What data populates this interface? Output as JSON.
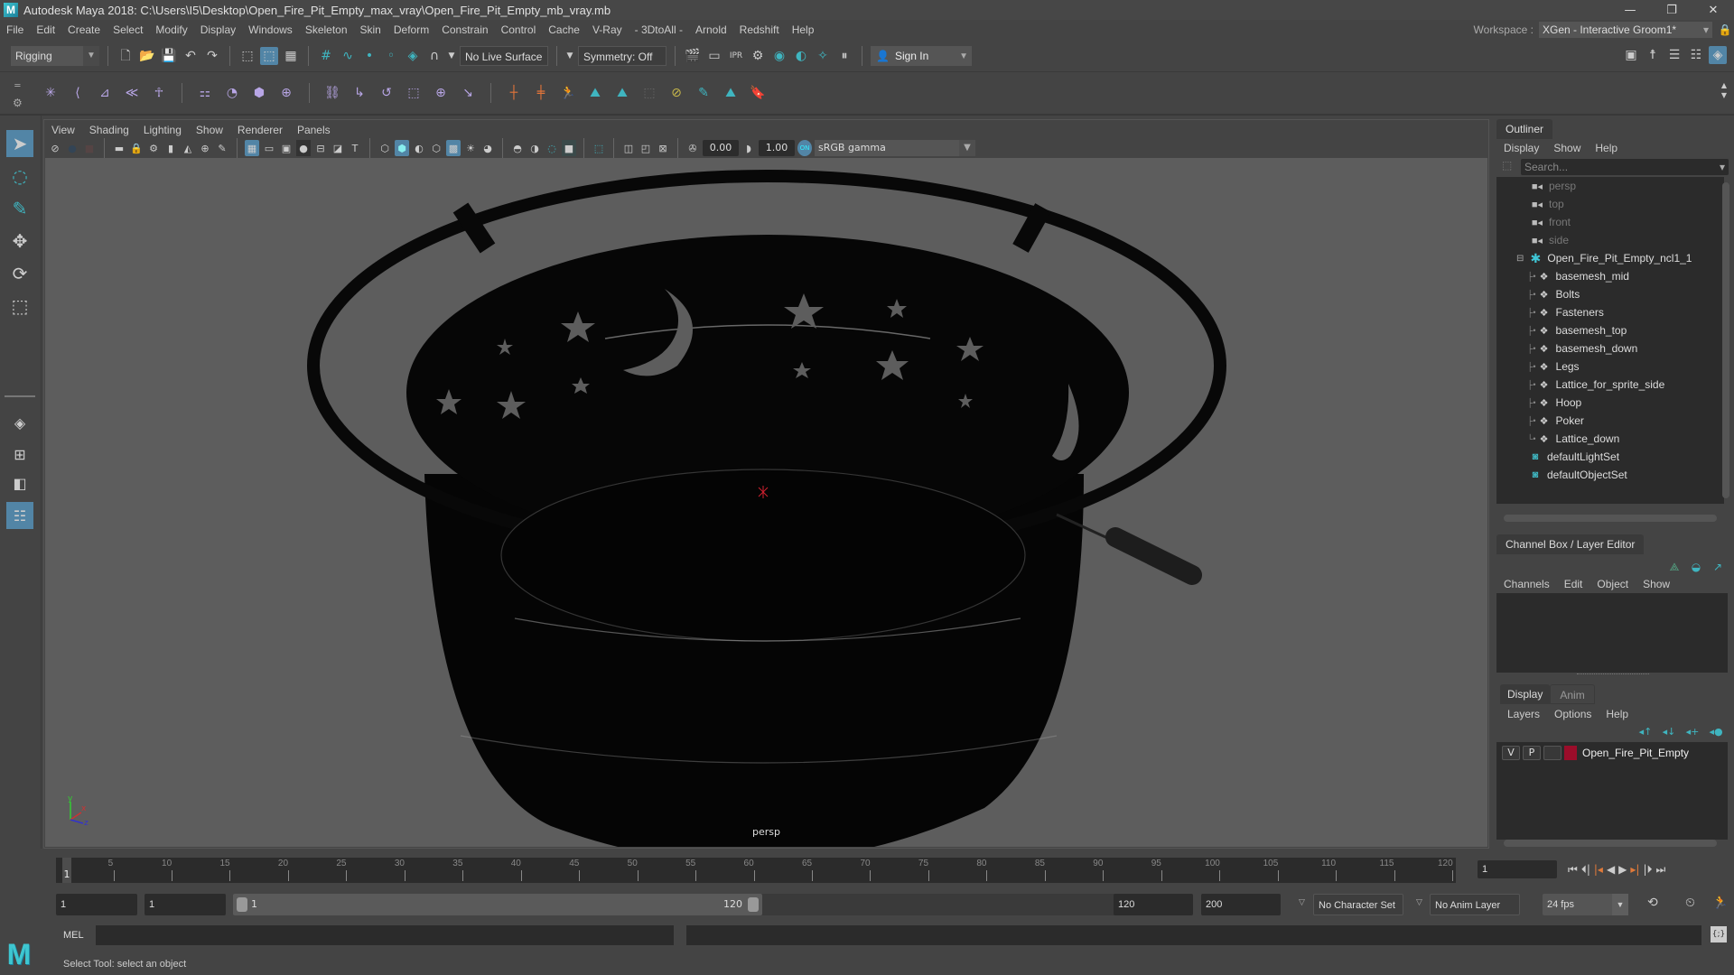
{
  "window": {
    "title": "Autodesk Maya 2018: C:\\Users\\I5\\Desktop\\Open_Fire_Pit_Empty_max_vray\\Open_Fire_Pit_Empty_mb_vray.mb",
    "controls": {
      "minimize": "—",
      "maximize": "❐",
      "close": "✕"
    }
  },
  "menubar": {
    "items": [
      "File",
      "Edit",
      "Create",
      "Select",
      "Modify",
      "Display",
      "Windows",
      "Skeleton",
      "Skin",
      "Deform",
      "Constrain",
      "Control",
      "Cache",
      "V-Ray",
      "- 3DtoAll -",
      "Arnold",
      "Redshift",
      "Help"
    ],
    "workspace_label": "Workspace :",
    "workspace_value": "XGen - Interactive Groom1*"
  },
  "statusline": {
    "menuset": "Rigging",
    "live_surface": "No Live Surface",
    "symmetry": "Symmetry: Off",
    "sign_in": "Sign In"
  },
  "viewport": {
    "menus": [
      "View",
      "Shading",
      "Lighting",
      "Show",
      "Renderer",
      "Panels"
    ],
    "exposure": "0.00",
    "gamma": "1.00",
    "color_space": "sRGB gamma",
    "color_mgmt_badge": "ON",
    "camera": "persp",
    "axis": {
      "x": "x",
      "y": "y",
      "z": "z"
    }
  },
  "outliner": {
    "tab": "Outliner",
    "menus": [
      "Display",
      "Show",
      "Help"
    ],
    "search_placeholder": "Search...",
    "cameras": [
      "persp",
      "top",
      "front",
      "side"
    ],
    "group": "Open_Fire_Pit_Empty_ncl1_1",
    "children": [
      "basemesh_mid",
      "Bolts",
      "Fasteners",
      "basemesh_top",
      "basemesh_down",
      "Legs",
      "Lattice_for_sprite_side",
      "Hoop",
      "Poker",
      "Lattice_down"
    ],
    "sets": [
      "defaultLightSet",
      "defaultObjectSet"
    ]
  },
  "channelbox": {
    "tab": "Channel Box / Layer Editor",
    "menus": [
      "Channels",
      "Edit",
      "Object",
      "Show"
    ],
    "layer_tabs": [
      "Display",
      "Anim"
    ],
    "layer_menus": [
      "Layers",
      "Options",
      "Help"
    ],
    "layers": [
      {
        "v": "V",
        "p": "P",
        "color": "#9b0d2a",
        "name": "Open_Fire_Pit_Empty"
      }
    ]
  },
  "timeline": {
    "start": 1,
    "end": 120,
    "step": 5,
    "current_frame": "1",
    "current_field": "1"
  },
  "range": {
    "anim_start": "1",
    "playback_start": "1",
    "slider_start": "1",
    "slider_end": "120",
    "playback_end": "120",
    "anim_end": "200",
    "character_set": "No Character Set",
    "anim_layer": "No Anim Layer",
    "fps": "24 fps"
  },
  "commandline": {
    "lang": "MEL"
  },
  "helpline": {
    "text": "Select Tool: select an object"
  }
}
